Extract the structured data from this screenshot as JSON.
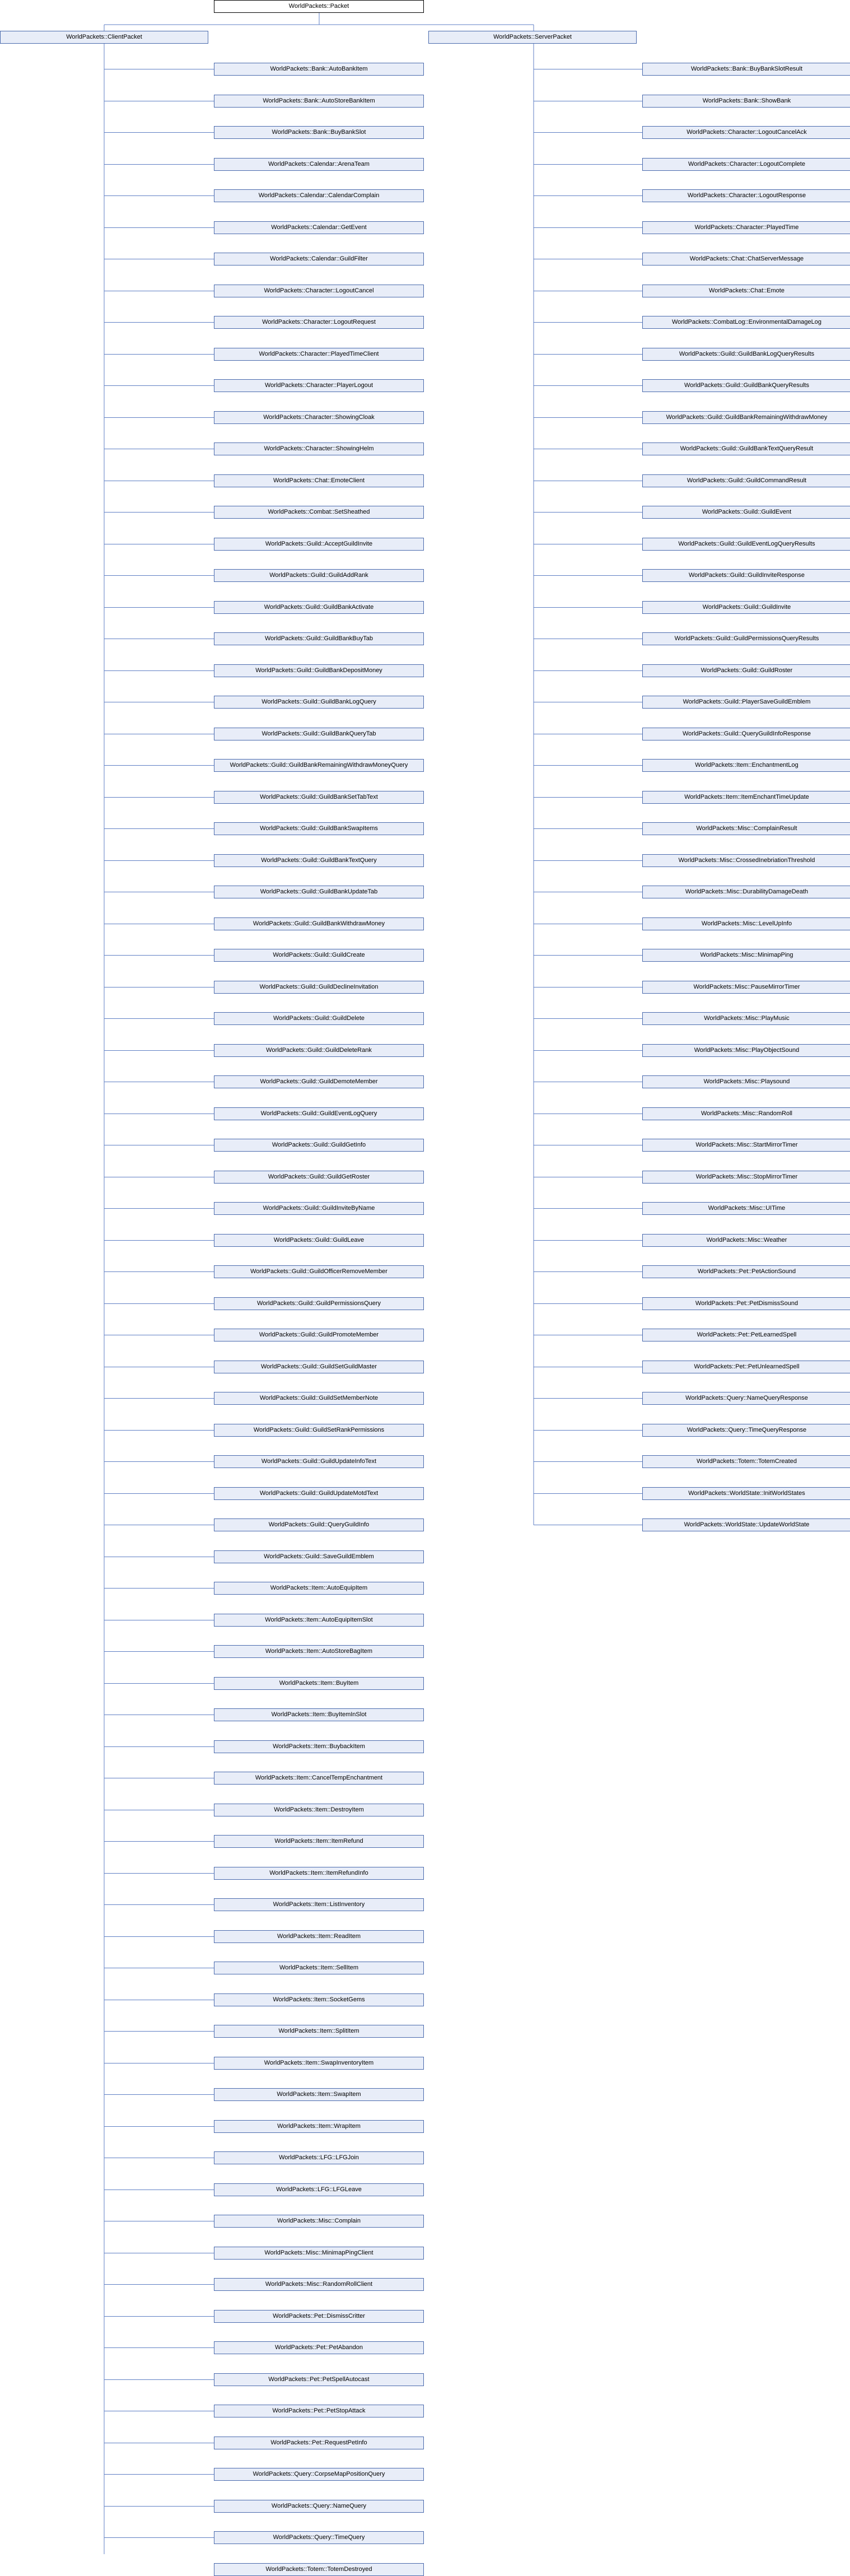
{
  "colors": {
    "edge": "#5f7fc4",
    "node_border": "#4a6aad",
    "node_fill": "#e8edf8",
    "root_border": "#000000"
  },
  "root": "WorldPackets::Packet",
  "client": {
    "name": "WorldPackets::ClientPacket",
    "children": [
      "WorldPackets::Bank::AutoBankItem",
      "WorldPackets::Bank::AutoStoreBankItem",
      "WorldPackets::Bank::BuyBankSlot",
      "WorldPackets::Calendar::ArenaTeam",
      "WorldPackets::Calendar::CalendarComplain",
      "WorldPackets::Calendar::GetEvent",
      "WorldPackets::Calendar::GuildFilter",
      "WorldPackets::Character::LogoutCancel",
      "WorldPackets::Character::LogoutRequest",
      "WorldPackets::Character::PlayedTimeClient",
      "WorldPackets::Character::PlayerLogout",
      "WorldPackets::Character::ShowingCloak",
      "WorldPackets::Character::ShowingHelm",
      "WorldPackets::Chat::EmoteClient",
      "WorldPackets::Combat::SetSheathed",
      "WorldPackets::Guild::AcceptGuildInvite",
      "WorldPackets::Guild::GuildAddRank",
      "WorldPackets::Guild::GuildBankActivate",
      "WorldPackets::Guild::GuildBankBuyTab",
      "WorldPackets::Guild::GuildBankDepositMoney",
      "WorldPackets::Guild::GuildBankLogQuery",
      "WorldPackets::Guild::GuildBankQueryTab",
      "WorldPackets::Guild::GuildBankRemainingWithdrawMoneyQuery",
      "WorldPackets::Guild::GuildBankSetTabText",
      "WorldPackets::Guild::GuildBankSwapItems",
      "WorldPackets::Guild::GuildBankTextQuery",
      "WorldPackets::Guild::GuildBankUpdateTab",
      "WorldPackets::Guild::GuildBankWithdrawMoney",
      "WorldPackets::Guild::GuildCreate",
      "WorldPackets::Guild::GuildDeclineInvitation",
      "WorldPackets::Guild::GuildDelete",
      "WorldPackets::Guild::GuildDeleteRank",
      "WorldPackets::Guild::GuildDemoteMember",
      "WorldPackets::Guild::GuildEventLogQuery",
      "WorldPackets::Guild::GuildGetInfo",
      "WorldPackets::Guild::GuildGetRoster",
      "WorldPackets::Guild::GuildInviteByName",
      "WorldPackets::Guild::GuildLeave",
      "WorldPackets::Guild::GuildOfficerRemoveMember",
      "WorldPackets::Guild::GuildPermissionsQuery",
      "WorldPackets::Guild::GuildPromoteMember",
      "WorldPackets::Guild::GuildSetGuildMaster",
      "WorldPackets::Guild::GuildSetMemberNote",
      "WorldPackets::Guild::GuildSetRankPermissions",
      "WorldPackets::Guild::GuildUpdateInfoText",
      "WorldPackets::Guild::GuildUpdateMotdText",
      "WorldPackets::Guild::QueryGuildInfo",
      "WorldPackets::Guild::SaveGuildEmblem",
      "WorldPackets::Item::AutoEquipItem",
      "WorldPackets::Item::AutoEquipItemSlot",
      "WorldPackets::Item::AutoStoreBagItem",
      "WorldPackets::Item::BuyItem",
      "WorldPackets::Item::BuyItemInSlot",
      "WorldPackets::Item::BuybackItem",
      "WorldPackets::Item::CancelTempEnchantment",
      "WorldPackets::Item::DestroyItem",
      "WorldPackets::Item::ItemRefund",
      "WorldPackets::Item::ItemRefundInfo",
      "WorldPackets::Item::ListInventory",
      "WorldPackets::Item::ReadItem",
      "WorldPackets::Item::SellItem",
      "WorldPackets::Item::SocketGems",
      "WorldPackets::Item::SplitItem",
      "WorldPackets::Item::SwapInventoryItem",
      "WorldPackets::Item::SwapItem",
      "WorldPackets::Item::WrapItem",
      "WorldPackets::LFG::LFGJoin",
      "WorldPackets::LFG::LFGLeave",
      "WorldPackets::Misc::Complain",
      "WorldPackets::Misc::MinimapPingClient",
      "WorldPackets::Misc::RandomRollClient",
      "WorldPackets::Pet::DismissCritter",
      "WorldPackets::Pet::PetAbandon",
      "WorldPackets::Pet::PetSpellAutocast",
      "WorldPackets::Pet::PetStopAttack",
      "WorldPackets::Pet::RequestPetInfo",
      "WorldPackets::Query::CorpseMapPositionQuery",
      "WorldPackets::Query::NameQuery",
      "WorldPackets::Query::TimeQuery",
      "WorldPackets::Totem::TotemDestroyed"
    ]
  },
  "server": {
    "name": "WorldPackets::ServerPacket",
    "children": [
      "WorldPackets::Bank::BuyBankSlotResult",
      "WorldPackets::Bank::ShowBank",
      "WorldPackets::Character::LogoutCancelAck",
      "WorldPackets::Character::LogoutComplete",
      "WorldPackets::Character::LogoutResponse",
      "WorldPackets::Character::PlayedTime",
      "WorldPackets::Chat::ChatServerMessage",
      "WorldPackets::Chat::Emote",
      "WorldPackets::CombatLog::EnvironmentalDamageLog",
      "WorldPackets::Guild::GuildBankLogQueryResults",
      "WorldPackets::Guild::GuildBankQueryResults",
      "WorldPackets::Guild::GuildBankRemainingWithdrawMoney",
      "WorldPackets::Guild::GuildBankTextQueryResult",
      "WorldPackets::Guild::GuildCommandResult",
      "WorldPackets::Guild::GuildEvent",
      "WorldPackets::Guild::GuildEventLogQueryResults",
      "WorldPackets::Guild::GuildInviteResponse",
      "WorldPackets::Guild::GuildInvite",
      "WorldPackets::Guild::GuildPermissionsQueryResults",
      "WorldPackets::Guild::GuildRoster",
      "WorldPackets::Guild::PlayerSaveGuildEmblem",
      "WorldPackets::Guild::QueryGuildInfoResponse",
      "WorldPackets::Item::EnchantmentLog",
      "WorldPackets::Item::ItemEnchantTimeUpdate",
      "WorldPackets::Misc::ComplainResult",
      "WorldPackets::Misc::CrossedInebriationThreshold",
      "WorldPackets::Misc::DurabilityDamageDeath",
      "WorldPackets::Misc::LevelUpInfo",
      "WorldPackets::Misc::MinimapPing",
      "WorldPackets::Misc::PauseMirrorTimer",
      "WorldPackets::Misc::PlayMusic",
      "WorldPackets::Misc::PlayObjectSound",
      "WorldPackets::Misc::Playsound",
      "WorldPackets::Misc::RandomRoll",
      "WorldPackets::Misc::StartMirrorTimer",
      "WorldPackets::Misc::StopMirrorTimer",
      "WorldPackets::Misc::UITime",
      "WorldPackets::Misc::Weather",
      "WorldPackets::Pet::PetActionSound",
      "WorldPackets::Pet::PetDismissSound",
      "WorldPackets::Pet::PetLearnedSpell",
      "WorldPackets::Pet::PetUnlearnedSpell",
      "WorldPackets::Query::NameQueryResponse",
      "WorldPackets::Query::TimeQueryResponse",
      "WorldPackets::Totem::TotemCreated",
      "WorldPackets::WorldState::InitWorldStates",
      "WorldPackets::WorldState::UpdateWorldState"
    ]
  }
}
